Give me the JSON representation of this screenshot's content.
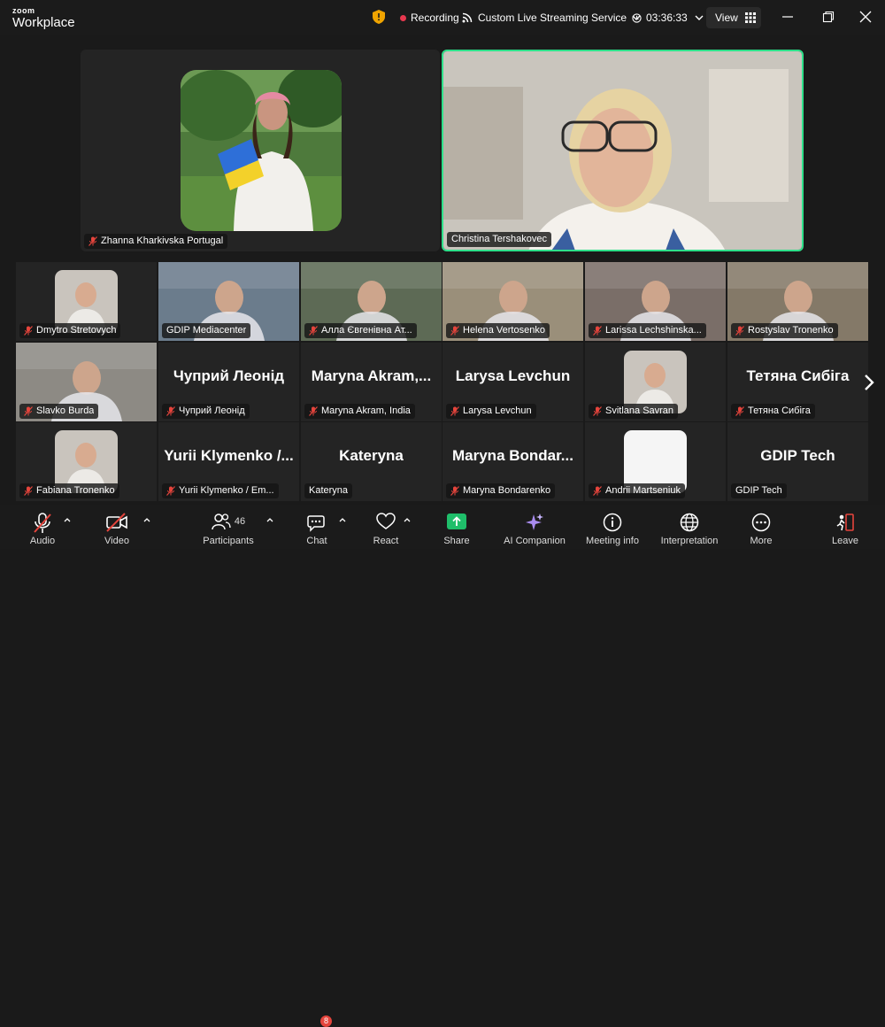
{
  "app": {
    "brand_small": "zoom",
    "brand_large": "Workplace"
  },
  "titlebar": {
    "recording_label": "Recording",
    "stream_label": "Custom Live Streaming Service",
    "timer": "03:36:33",
    "view_label": "View"
  },
  "speakers": [
    {
      "name": "Zhanna Kharkivska Portugal",
      "muted": true
    },
    {
      "name": "Christina Tershakovec",
      "muted": false
    }
  ],
  "gallery": {
    "row1": [
      {
        "name": "Dmytro Stretovych",
        "muted": true,
        "display": "photo"
      },
      {
        "name": "GDIP Mediacenter",
        "muted": false,
        "display": "video"
      },
      {
        "name": "Алла Євгенівна Ат...",
        "muted": true,
        "display": "video"
      },
      {
        "name": "Helena Vertosenko",
        "muted": true,
        "display": "video"
      },
      {
        "name": "Larissa Lechshinska...",
        "muted": true,
        "display": "video"
      },
      {
        "name": "Rostyslav Tronenko",
        "muted": true,
        "display": "video"
      }
    ],
    "row2": [
      {
        "name": "Slavko Burda",
        "muted": true,
        "display": "video",
        "big": ""
      },
      {
        "name": "Чуприй Леонід",
        "muted": true,
        "display": "text",
        "big": "Чуприй Леонід"
      },
      {
        "name": "Maryna Akram, India",
        "muted": true,
        "display": "text",
        "big": "Maryna Akram,..."
      },
      {
        "name": "Larysa Levchun",
        "muted": true,
        "display": "text",
        "big": "Larysa Levchun"
      },
      {
        "name": "Svitlana Savran",
        "muted": true,
        "display": "photo",
        "big": ""
      },
      {
        "name": "Тетяна Сибіга",
        "muted": true,
        "display": "text",
        "big": "Тетяна Сибіга"
      }
    ],
    "row3": [
      {
        "name": "Fabiana Tronenko",
        "muted": true,
        "display": "photo",
        "big": ""
      },
      {
        "name": "Yurii Klymenko / Em...",
        "muted": true,
        "display": "text",
        "big": "Yurii Klymenko /..."
      },
      {
        "name": "Kateryna",
        "muted": false,
        "display": "text",
        "big": "Kateryna"
      },
      {
        "name": "Maryna Bondarenko",
        "muted": true,
        "display": "text",
        "big": "Maryna Bondar..."
      },
      {
        "name": "Andrii Martseniuk",
        "muted": true,
        "display": "blank",
        "big": ""
      },
      {
        "name": "GDIP Tech",
        "muted": false,
        "display": "text",
        "big": "GDIP Tech"
      }
    ]
  },
  "toolbar": {
    "audio": "Audio",
    "video": "Video",
    "participants": "Participants",
    "participants_count": "46",
    "chat": "Chat",
    "chat_badge": "8",
    "react": "React",
    "share": "Share",
    "ai": "AI Companion",
    "info": "Meeting info",
    "interpretation": "Interpretation",
    "more": "More",
    "leave": "Leave"
  },
  "colors": {
    "active_speaker": "#2ee08a",
    "share_green": "#1fbe6a",
    "recording_red": "#e8384f",
    "muted_red": "#e5443c",
    "ai_purple": "#a98cf0"
  }
}
